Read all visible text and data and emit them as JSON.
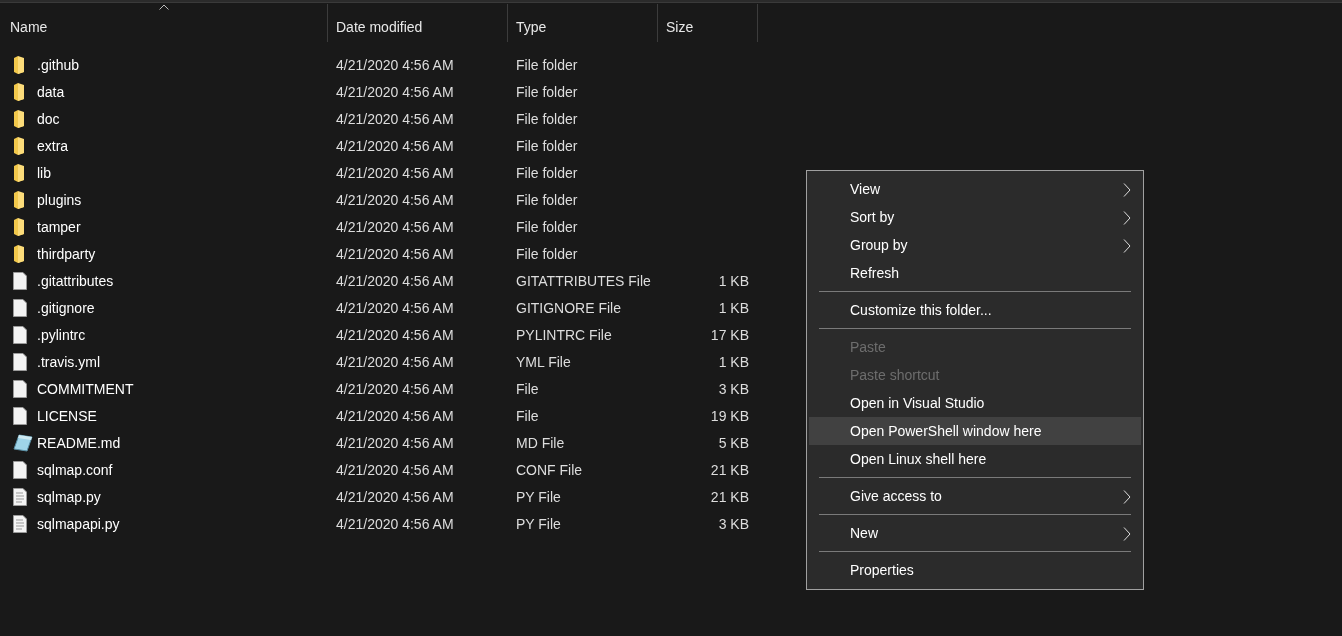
{
  "columns": [
    {
      "label": "Name",
      "sorted": true
    },
    {
      "label": "Date modified",
      "sorted": false
    },
    {
      "label": "Type",
      "sorted": false
    },
    {
      "label": "Size",
      "sorted": false
    }
  ],
  "files": [
    {
      "name": ".github",
      "date": "4/21/2020 4:56 AM",
      "type": "File folder",
      "kind": "folder"
    },
    {
      "name": "data",
      "date": "4/21/2020 4:56 AM",
      "type": "File folder",
      "kind": "folder"
    },
    {
      "name": "doc",
      "date": "4/21/2020 4:56 AM",
      "type": "File folder",
      "kind": "folder"
    },
    {
      "name": "extra",
      "date": "4/21/2020 4:56 AM",
      "type": "File folder",
      "kind": "folder"
    },
    {
      "name": "lib",
      "date": "4/21/2020 4:56 AM",
      "type": "File folder",
      "kind": "folder"
    },
    {
      "name": "plugins",
      "date": "4/21/2020 4:56 AM",
      "type": "File folder",
      "kind": "folder"
    },
    {
      "name": "tamper",
      "date": "4/21/2020 4:56 AM",
      "type": "File folder",
      "kind": "folder"
    },
    {
      "name": "thirdparty",
      "date": "4/21/2020 4:56 AM",
      "type": "File folder",
      "kind": "folder"
    },
    {
      "name": ".gitattributes",
      "date": "4/21/2020 4:56 AM",
      "type": "GITATTRIBUTES File",
      "size": "1 KB",
      "kind": "file"
    },
    {
      "name": ".gitignore",
      "date": "4/21/2020 4:56 AM",
      "type": "GITIGNORE File",
      "size": "1 KB",
      "kind": "file"
    },
    {
      "name": ".pylintrc",
      "date": "4/21/2020 4:56 AM",
      "type": "PYLINTRC File",
      "size": "17 KB",
      "kind": "file"
    },
    {
      "name": ".travis.yml",
      "date": "4/21/2020 4:56 AM",
      "type": "YML File",
      "size": "1 KB",
      "kind": "file"
    },
    {
      "name": "COMMITMENT",
      "date": "4/21/2020 4:56 AM",
      "type": "File",
      "size": "3 KB",
      "kind": "file"
    },
    {
      "name": "LICENSE",
      "date": "4/21/2020 4:56 AM",
      "type": "File",
      "size": "19 KB",
      "kind": "file"
    },
    {
      "name": "README.md",
      "date": "4/21/2020 4:56 AM",
      "type": "MD File",
      "size": "5 KB",
      "kind": "markdown"
    },
    {
      "name": "sqlmap.conf",
      "date": "4/21/2020 4:56 AM",
      "type": "CONF File",
      "size": "21 KB",
      "kind": "file"
    },
    {
      "name": "sqlmap.py",
      "date": "4/21/2020 4:56 AM",
      "type": "PY File",
      "size": "21 KB",
      "kind": "text"
    },
    {
      "name": "sqlmapapi.py",
      "date": "4/21/2020 4:56 AM",
      "type": "PY File",
      "size": "3 KB",
      "kind": "text"
    }
  ],
  "context_menu": [
    {
      "kind": "item",
      "label": "View",
      "submenu": true,
      "disabled": false,
      "highlighted": false
    },
    {
      "kind": "item",
      "label": "Sort by",
      "submenu": true,
      "disabled": false,
      "highlighted": false
    },
    {
      "kind": "item",
      "label": "Group by",
      "submenu": true,
      "disabled": false,
      "highlighted": false
    },
    {
      "kind": "item",
      "label": "Refresh",
      "submenu": false,
      "disabled": false,
      "highlighted": false
    },
    {
      "kind": "separator"
    },
    {
      "kind": "item",
      "label": "Customize this folder...",
      "submenu": false,
      "disabled": false,
      "highlighted": false
    },
    {
      "kind": "separator"
    },
    {
      "kind": "item",
      "label": "Paste",
      "submenu": false,
      "disabled": true,
      "highlighted": false
    },
    {
      "kind": "item",
      "label": "Paste shortcut",
      "submenu": false,
      "disabled": true,
      "highlighted": false
    },
    {
      "kind": "item",
      "label": "Open in Visual Studio",
      "submenu": false,
      "disabled": false,
      "highlighted": false
    },
    {
      "kind": "item",
      "label": "Open PowerShell window here",
      "submenu": false,
      "disabled": false,
      "highlighted": true
    },
    {
      "kind": "item",
      "label": "Open Linux shell here",
      "submenu": false,
      "disabled": false,
      "highlighted": false
    },
    {
      "kind": "separator"
    },
    {
      "kind": "item",
      "label": "Give access to",
      "submenu": true,
      "disabled": false,
      "highlighted": false
    },
    {
      "kind": "separator"
    },
    {
      "kind": "item",
      "label": "New",
      "submenu": true,
      "disabled": false,
      "highlighted": false
    },
    {
      "kind": "separator"
    },
    {
      "kind": "item",
      "label": "Properties",
      "submenu": false,
      "disabled": false,
      "highlighted": false
    }
  ]
}
